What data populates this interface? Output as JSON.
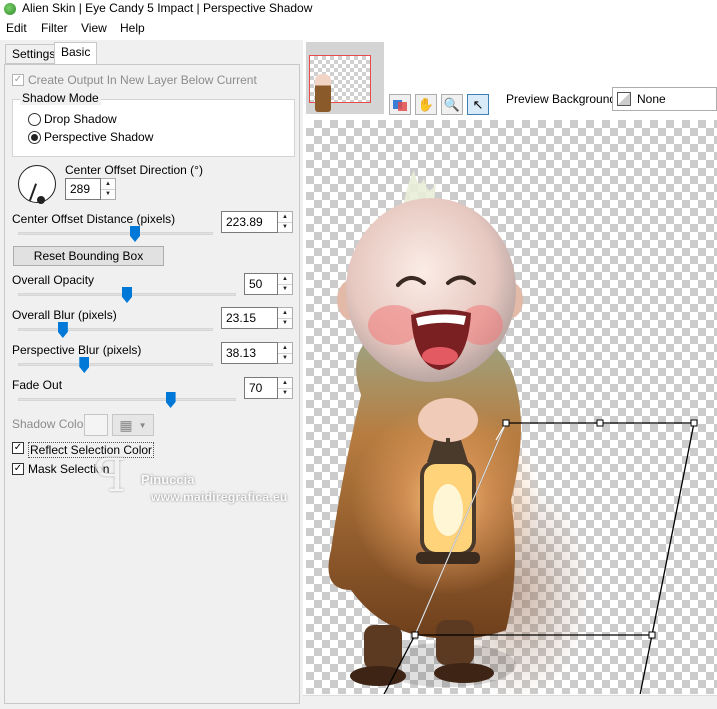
{
  "window": {
    "title": "Alien Skin | Eye Candy 5 Impact | Perspective Shadow"
  },
  "menu": [
    "Edit",
    "Filter",
    "View",
    "Help"
  ],
  "tabs": {
    "settings": "Settings",
    "basic": "Basic"
  },
  "basic": {
    "create_output_label": "Create Output In New Layer Below Current",
    "create_output_checked": true,
    "shadow_mode": {
      "title": "Shadow Mode",
      "drop_label": "Drop Shadow",
      "perspective_label": "Perspective Shadow",
      "selected": "perspective"
    },
    "direction": {
      "label": "Center Offset Direction (°)",
      "value": "289"
    },
    "distance": {
      "label": "Center Offset Distance (pixels)",
      "value": "223.89",
      "fraction": 0.6
    },
    "reset_label": "Reset Bounding Box",
    "opacity": {
      "label": "Overall Opacity",
      "value": "50",
      "fraction": 0.5
    },
    "blur": {
      "label": "Overall Blur (pixels)",
      "value": "23.15",
      "fraction": 0.23
    },
    "perspective_blur": {
      "label": "Perspective Blur (pixels)",
      "value": "38.13",
      "fraction": 0.34
    },
    "fade_out": {
      "label": "Fade Out",
      "value": "70",
      "fraction": 0.7
    },
    "shadow_color_label": "Shadow Color",
    "reflect_label": "Reflect Selection Color",
    "reflect_checked": true,
    "mask_label": "Mask Selection",
    "mask_checked": true
  },
  "watermark": {
    "line1": "Pinuccia",
    "line2": "www.maidiregrafica.eu"
  },
  "preview": {
    "background_label": "Preview Background:",
    "background_value": "None"
  },
  "tools": [
    {
      "name": "hand-icon",
      "glyph": "✋"
    },
    {
      "name": "zoom-icon",
      "glyph": "🔍"
    },
    {
      "name": "pointer-icon",
      "glyph": "↖"
    }
  ]
}
